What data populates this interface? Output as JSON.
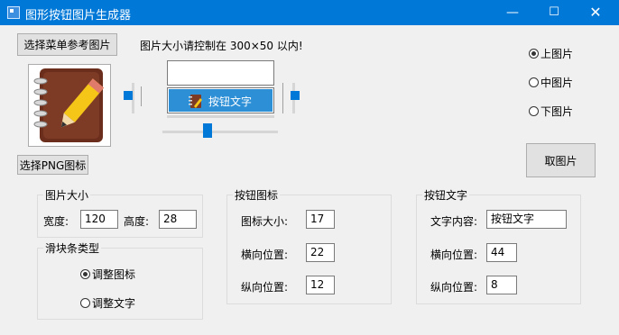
{
  "window": {
    "title": "图形按钮图片生成器",
    "minimize_icon": "minimize-icon",
    "maximize_icon": "maximize-icon",
    "close_icon": "close-icon"
  },
  "top": {
    "select_menu_ref_button": "选择菜单参考图片",
    "size_hint": "图片大小请控制在 300×50 以内!",
    "select_png_icon_button": "选择PNG图标",
    "preview_button_text": "按钮文字"
  },
  "position_radios": [
    {
      "label": "上图片",
      "checked": true
    },
    {
      "label": "中图片",
      "checked": false
    },
    {
      "label": "下图片",
      "checked": false
    }
  ],
  "fetch_button": "取图片",
  "image_size_group": {
    "title": "图片大小",
    "width_label": "宽度:",
    "width_value": "120",
    "height_label": "高度:",
    "height_value": "28"
  },
  "slider_type_group": {
    "title": "滑块条类型",
    "options": [
      {
        "label": "调整图标",
        "checked": true
      },
      {
        "label": "调整文字",
        "checked": false
      }
    ]
  },
  "button_icon_group": {
    "title": "按钮图标",
    "size_label": "图标大小:",
    "size_value": "17",
    "h_label": "横向位置:",
    "h_value": "22",
    "v_label": "纵向位置:",
    "v_value": "12"
  },
  "button_text_group": {
    "title": "按钮文字",
    "content_label": "文字内容:",
    "content_value": "按钮文字",
    "h_label": "横向位置:",
    "h_value": "44",
    "v_label": "纵向位置:",
    "v_value": "8"
  },
  "colors": {
    "titlebar": "#0078d7",
    "preview_bg": "#2d8fd6",
    "slider_thumb": "#0078d7"
  }
}
